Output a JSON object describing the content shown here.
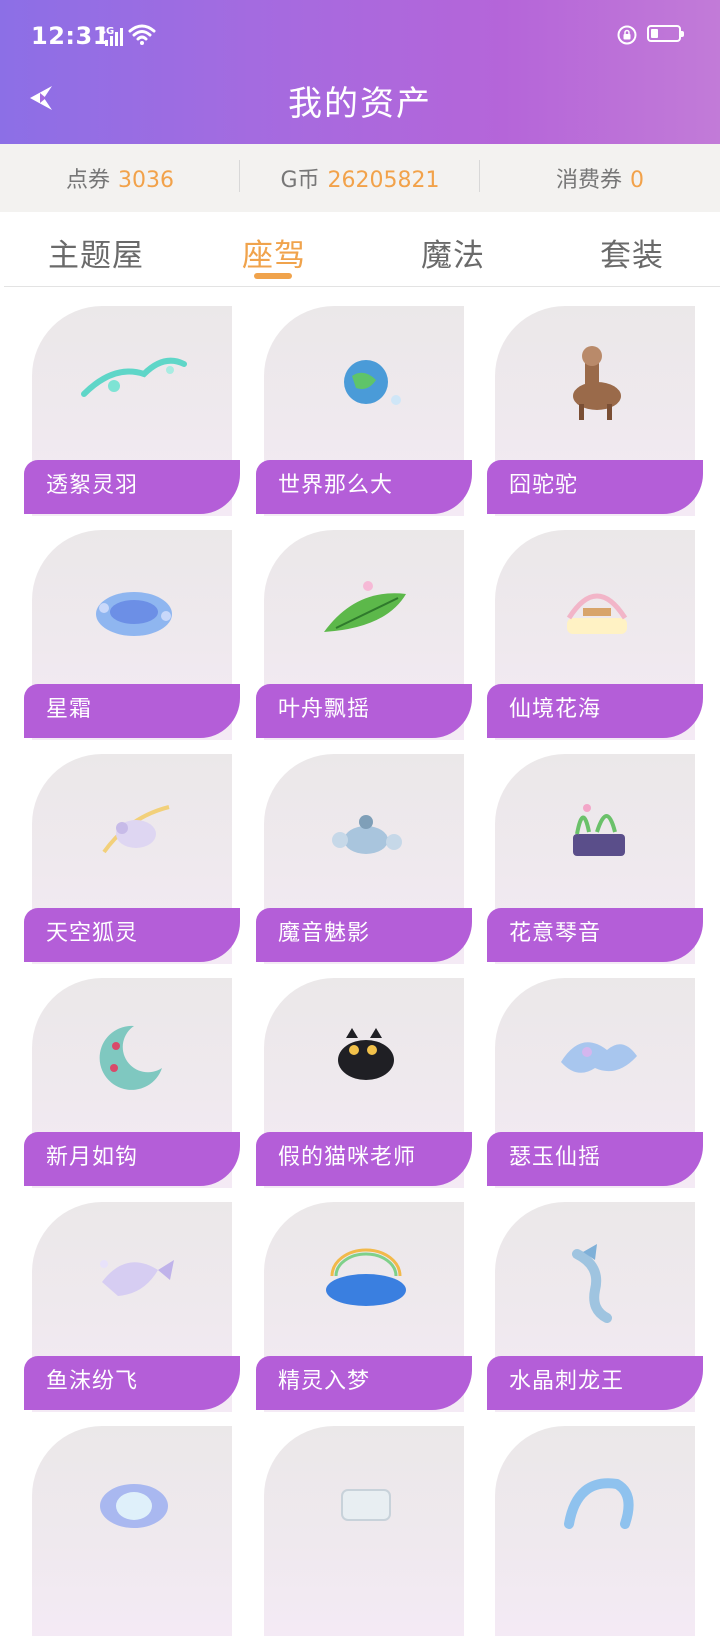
{
  "status_bar": {
    "time": "12:31",
    "network": "4G"
  },
  "header": {
    "title": "我的资产"
  },
  "currency": [
    {
      "label": "点券",
      "value": "3036"
    },
    {
      "label": "G币",
      "value": "26205821"
    },
    {
      "label": "消费券",
      "value": "0"
    }
  ],
  "tabs": [
    {
      "label": "主题屋",
      "active": false
    },
    {
      "label": "座驾",
      "active": true
    },
    {
      "label": "魔法",
      "active": false
    },
    {
      "label": "套装",
      "active": false
    }
  ],
  "items": [
    {
      "name": "透絮灵羽",
      "icon": "feather-wing-icon"
    },
    {
      "name": "世界那么大",
      "icon": "globe-icon"
    },
    {
      "name": "囧驼驼",
      "icon": "alpaca-icon"
    },
    {
      "name": "星霜",
      "icon": "disc-platform-icon"
    },
    {
      "name": "叶舟飘摇",
      "icon": "leaf-boat-icon"
    },
    {
      "name": "仙境花海",
      "icon": "flower-swing-icon"
    },
    {
      "name": "天空狐灵",
      "icon": "fox-spirit-icon"
    },
    {
      "name": "魔音魅影",
      "icon": "magic-sound-icon"
    },
    {
      "name": "花意琴音",
      "icon": "flower-piano-icon"
    },
    {
      "name": "新月如钩",
      "icon": "crescent-moon-icon"
    },
    {
      "name": "假的猫咪老师",
      "icon": "black-cat-icon"
    },
    {
      "name": "瑟玉仙摇",
      "icon": "jade-cloud-icon"
    },
    {
      "name": "鱼沫纷飞",
      "icon": "fish-bubble-icon"
    },
    {
      "name": "精灵入梦",
      "icon": "rainbow-cloud-icon"
    },
    {
      "name": "水晶刺龙王",
      "icon": "crystal-dragon-icon"
    },
    {
      "name": "",
      "icon": "ring-portal-icon"
    },
    {
      "name": "",
      "icon": "crystal-box-icon"
    },
    {
      "name": "",
      "icon": "water-arch-icon"
    }
  ]
}
